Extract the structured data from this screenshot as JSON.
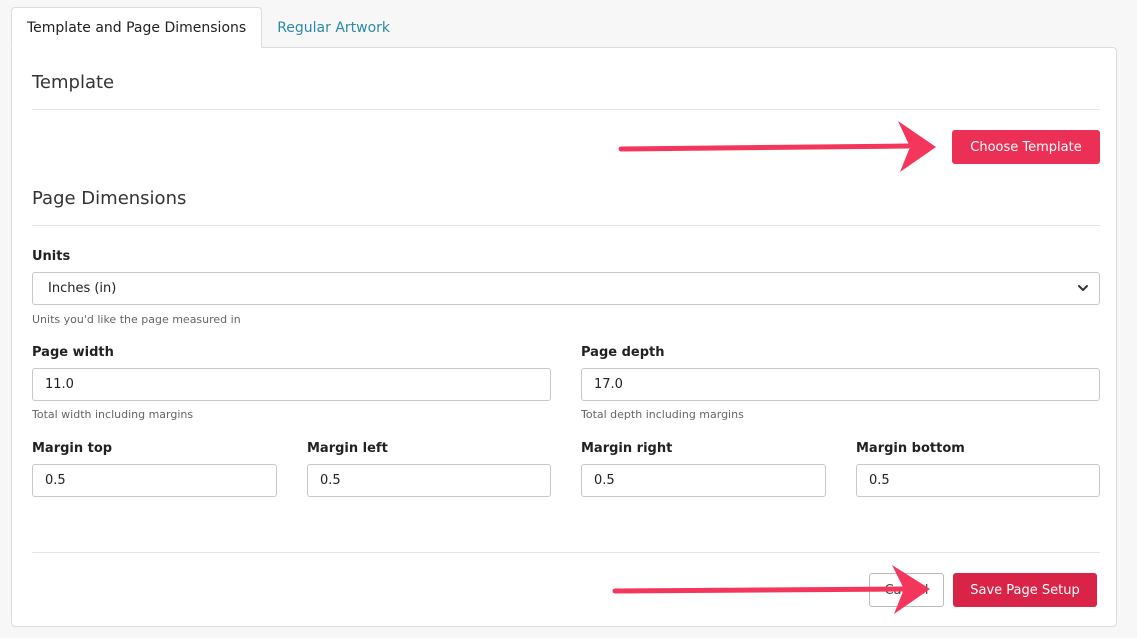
{
  "tabs": [
    {
      "label": "Template and Page Dimensions",
      "active": true
    },
    {
      "label": "Regular Artwork",
      "active": false
    }
  ],
  "template_section": {
    "title": "Template",
    "choose_button": "Choose Template"
  },
  "dimensions_section": {
    "title": "Page Dimensions",
    "units": {
      "label": "Units",
      "value": "Inches (in)",
      "help": "Units you'd like the page measured in"
    },
    "page_width": {
      "label": "Page width",
      "value": "11.0",
      "help": "Total width including margins"
    },
    "page_depth": {
      "label": "Page depth",
      "value": "17.0",
      "help": "Total depth including margins"
    },
    "margin_top": {
      "label": "Margin top",
      "value": "0.5"
    },
    "margin_left": {
      "label": "Margin left",
      "value": "0.5"
    },
    "margin_right": {
      "label": "Margin right",
      "value": "0.5"
    },
    "margin_bottom": {
      "label": "Margin bottom",
      "value": "0.5"
    }
  },
  "footer": {
    "cancel_label": "Cancel",
    "save_label": "Save Page Setup"
  },
  "colors": {
    "accent": "#ec2f55",
    "arrow": "#f5365c",
    "link": "#2a8aa8"
  },
  "icons": {
    "select_chevron": "chevron-down-icon",
    "annotation": "arrow-right-icon"
  }
}
